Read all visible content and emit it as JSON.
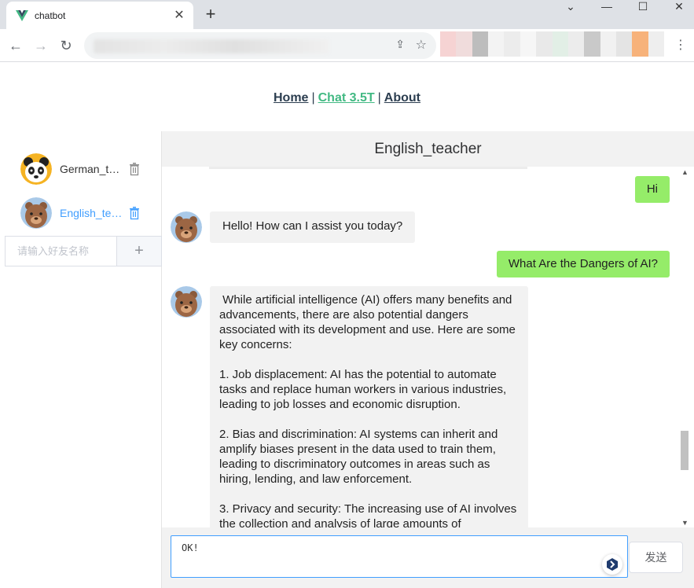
{
  "browser": {
    "tab_title": "chatbot",
    "close_glyph": "✕",
    "newtab_glyph": "+",
    "win_min": "⌄",
    "win_minimize": "—",
    "win_max": "☐",
    "win_close": "✕",
    "back_glyph": "←",
    "forward_glyph": "→",
    "reload_glyph": "↻",
    "share_glyph": "⇪",
    "star_glyph": "☆",
    "menu_glyph": "⋮"
  },
  "nav": {
    "home": "Home",
    "chat": "Chat 3.5T",
    "about": "About",
    "separator": "|"
  },
  "sidebar": {
    "friends": [
      {
        "name": "German_teacher",
        "avatar": "panda-icon"
      },
      {
        "name": "English_teacher",
        "avatar": "bear-icon"
      }
    ],
    "add_placeholder": "请输入好友名称",
    "add_glyph": "+"
  },
  "chat": {
    "title": "English_teacher",
    "messages": [
      {
        "role": "user",
        "text": "Hi"
      },
      {
        "role": "bot",
        "text": "Hello! How can I assist you today?"
      },
      {
        "role": "user",
        "text": "What Are the Dangers of AI?"
      },
      {
        "role": "bot",
        "text": " While artificial intelligence (AI) offers many benefits and advancements, there are also potential dangers associated with its development and use. Here are some key concerns:\n\n1. Job displacement: AI has the potential to automate tasks and replace human workers in various industries, leading to job losses and economic disruption.\n\n2. Bias and discrimination: AI systems can inherit and amplify biases present in the data used to train them, leading to discriminatory outcomes in areas such as hiring, lending, and law enforcement.\n\n3. Privacy and security: The increasing use of AI involves the collection and analysis of large amounts of"
      }
    ],
    "input_value": "OK!",
    "send_label": "发送"
  },
  "colors": {
    "accent_green": "#42b983",
    "user_bubble": "#95ec69",
    "active_blue": "#409eff"
  }
}
